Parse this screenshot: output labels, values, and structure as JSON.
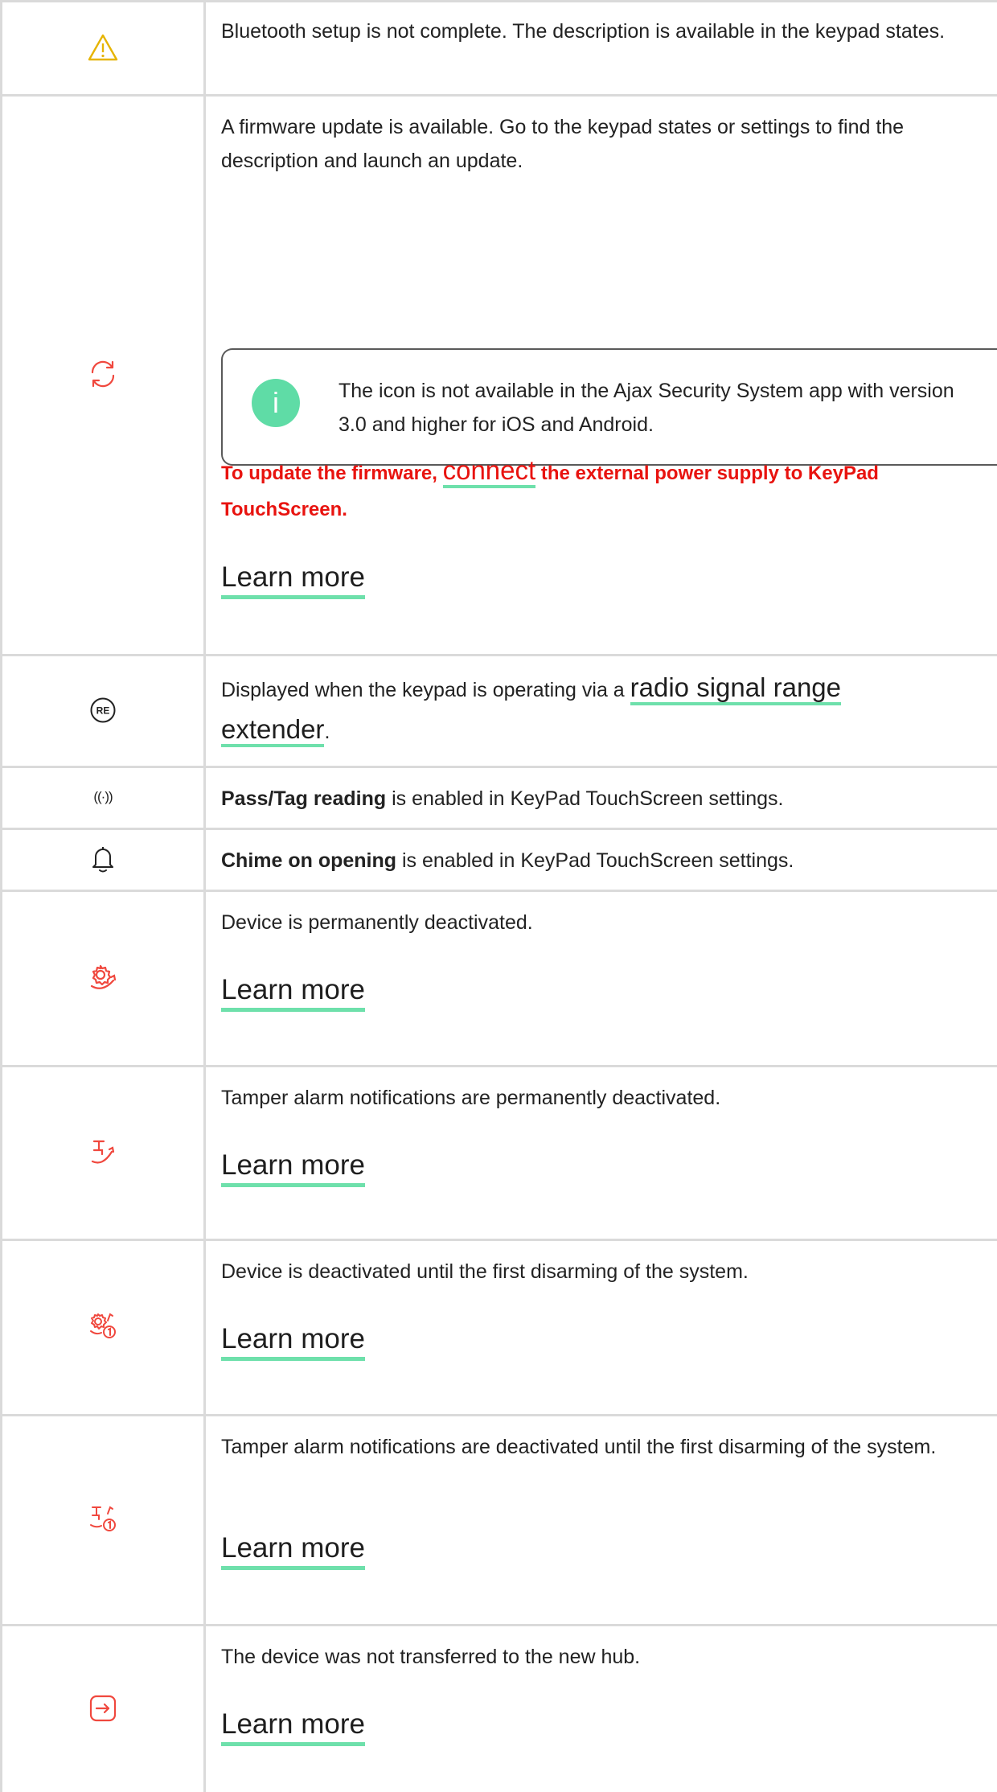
{
  "rows": [
    {
      "icon": "warning-triangle-icon",
      "text": "Bluetooth setup is not complete. The description is available in the keypad states."
    },
    {
      "icon": "firmware-update-icon",
      "text": "A firmware update is available. Go to the keypad states or settings to find the description and launch an update.",
      "note": {
        "badge": "i",
        "text": "The icon is not available in the Ajax Security System app with version 3.0 and higher for iOS and Android."
      },
      "warning": {
        "before": "To update the firmware, ",
        "link": "connect",
        "after": " the external power supply to KeyPad TouchScreen."
      },
      "learn_more": "Learn more"
    },
    {
      "icon": "range-extender-icon",
      "icon_label": "RE",
      "text_before": "Displayed when the keypad is operating via a ",
      "link": "radio signal range extender",
      "text_after": "."
    },
    {
      "icon": "pass-tag-reading-icon",
      "icon_label": "((·))",
      "bold": "Pass/Tag reading",
      "text": " is enabled in KeyPad TouchScreen settings."
    },
    {
      "icon": "chime-bell-icon",
      "bold": "Chime on opening",
      "text": " is enabled in KeyPad TouchScreen settings."
    },
    {
      "icon": "device-deactivated-icon",
      "text": "Device is permanently deactivated.",
      "learn_more": "Learn more"
    },
    {
      "icon": "tamper-deactivated-icon",
      "text": "Tamper alarm notifications are permanently deactivated.",
      "learn_more": "Learn more"
    },
    {
      "icon": "device-deactivated-until-disarm-icon",
      "text": "Device is deactivated until the first disarming of the system.",
      "learn_more": "Learn more"
    },
    {
      "icon": "tamper-deactivated-until-disarm-icon",
      "text": "Tamper alarm notifications are deactivated until the first disarming of the system.",
      "learn_more": "Learn more"
    },
    {
      "icon": "not-transferred-icon",
      "text": "The device was not transferred to the new hub.",
      "learn_more": "Learn more"
    }
  ],
  "colors": {
    "icon_red": "#f0483e",
    "warning_yellow": "#e6b400",
    "accent_green": "#6ee0ab",
    "warning_text": "#e8130f",
    "grid": "#dadada"
  }
}
